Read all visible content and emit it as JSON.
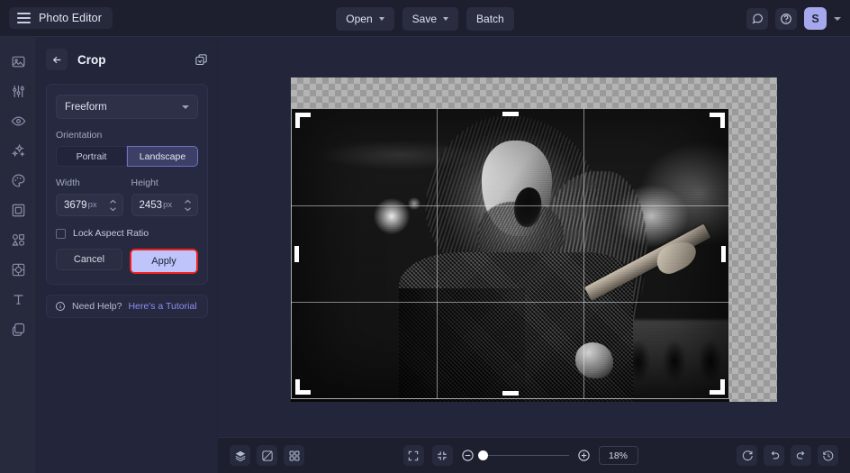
{
  "app": {
    "brand": "Photo Editor",
    "accent_purple": "#8b90f0",
    "apply_button_bg": "#bfc4fb",
    "highlight_box": "#f02020",
    "avatar_bg": "#a6a8ee"
  },
  "topbar": {
    "menu_icon": "hamburger-icon",
    "buttons": [
      {
        "label": "Open",
        "has_caret": true
      },
      {
        "label": "Save",
        "has_caret": true
      },
      {
        "label": "Batch",
        "has_caret": false
      }
    ],
    "right_icons": [
      "feedback-icon",
      "help-icon"
    ],
    "avatar_initial": "S",
    "avatar_caret": "chevron-down-icon"
  },
  "rail": {
    "items": [
      {
        "name": "image-icon"
      },
      {
        "name": "adjust-sliders-icon"
      },
      {
        "name": "eye-icon"
      },
      {
        "name": "sparkles-icon"
      },
      {
        "name": "palette-icon"
      },
      {
        "name": "frame-icon"
      },
      {
        "name": "shapes-icon"
      },
      {
        "name": "crop-overlay-icon"
      },
      {
        "name": "text-icon"
      },
      {
        "name": "layers-icon"
      }
    ]
  },
  "panel": {
    "back_icon": "arrow-left-icon",
    "title": "Crop",
    "header_icon": "duplicate-icon",
    "aspect_select": {
      "value": "Freeform",
      "caret": "chevron-down-icon"
    },
    "orientation": {
      "label": "Orientation",
      "options": [
        "Portrait",
        "Landscape"
      ],
      "selected": "Landscape"
    },
    "width": {
      "label": "Width",
      "value": "3679",
      "unit": "px",
      "stepper": "number-stepper"
    },
    "height": {
      "label": "Height",
      "value": "2453",
      "unit": "px",
      "stepper": "number-stepper"
    },
    "lock_aspect": {
      "label": "Lock Aspect Ratio",
      "checked": false
    },
    "cancel_label": "Cancel",
    "apply_label": "Apply",
    "help": {
      "icon": "info-icon",
      "text": "Need Help?",
      "link": "Here's a Tutorial"
    }
  },
  "canvas": {
    "crop_grid": "rule-of-thirds",
    "handles": [
      "top-left",
      "top-center",
      "top-right",
      "left-center",
      "right-center",
      "bottom-left",
      "bottom-center",
      "bottom-right"
    ]
  },
  "bottombar": {
    "left_icons": [
      "layers-stack-icon",
      "compare-icon",
      "grid-view-icon"
    ],
    "fit_icons": [
      "fit-screen-icon",
      "actual-size-icon"
    ],
    "zoom_out_icon": "zoom-out-icon",
    "zoom_in_icon": "zoom-in-icon",
    "zoom_value": "18%",
    "right_icons": [
      "rotate-icon",
      "undo-icon",
      "redo-icon",
      "history-icon"
    ]
  }
}
